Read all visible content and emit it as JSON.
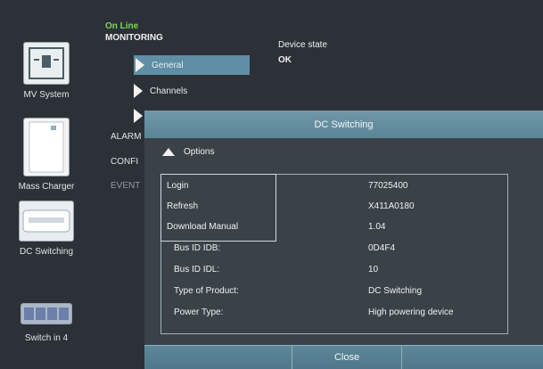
{
  "sidebar": {
    "devices": [
      {
        "label": "MV System",
        "icon": "mv-system-icon"
      },
      {
        "label": "Mass Charger",
        "icon": "charger-icon"
      },
      {
        "label": "DC Switching",
        "icon": "dc-switching-icon"
      },
      {
        "label": "Switch in 4",
        "icon": "switch-icon"
      }
    ]
  },
  "status": {
    "online": "On Line",
    "monitoring": "MONITORING"
  },
  "device_state": {
    "label": "Device state",
    "value": "OK"
  },
  "menu": {
    "general": "General",
    "channels": "Channels"
  },
  "side_partial": {
    "alarm": "ALARM",
    "config": "CONFI",
    "event": "EVENT"
  },
  "modal": {
    "title": "DC Switching",
    "options_label": "Options",
    "rows": [
      {
        "key": "Login",
        "value": "77025400"
      },
      {
        "key": "Refresh",
        "value": "X411A0180"
      },
      {
        "key": "Download Manual",
        "value": "1.04"
      },
      {
        "key": "Bus ID IDB:",
        "value": "0D4F4"
      },
      {
        "key": "Bus ID IDL:",
        "value": "10"
      },
      {
        "key": "Type of Product:",
        "value": "DC Switching"
      },
      {
        "key": "Power Type:",
        "value": "High powering device"
      }
    ],
    "close_label": "Close"
  },
  "colors": {
    "accent": "#5f8ea5",
    "online": "#7ed957",
    "background": "#2b3136"
  }
}
